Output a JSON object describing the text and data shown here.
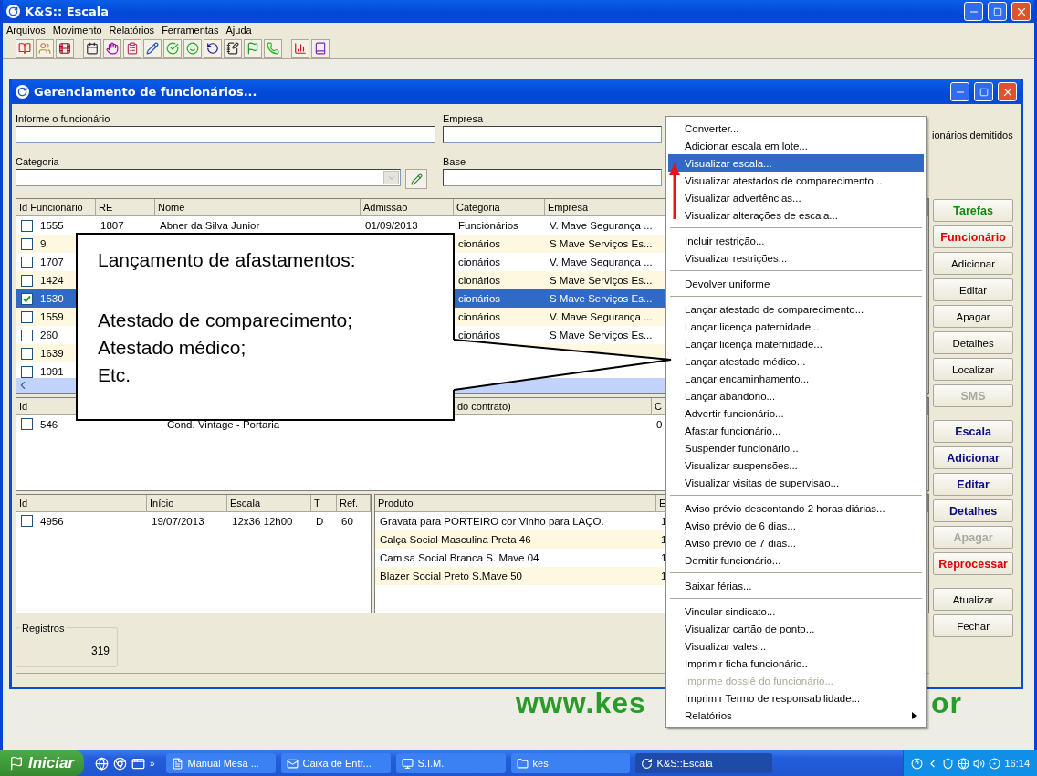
{
  "app": {
    "title": "K&S:: Escala",
    "menu": [
      "Arquivos",
      "Movimento",
      "Relatórios",
      "Ferramentas",
      "Ajuda"
    ]
  },
  "child": {
    "title": "Gerenciamento de funcionários...",
    "fields": [
      {
        "label": "Informe o funcionário",
        "kind": "text"
      },
      {
        "label": "Empresa",
        "kind": "text"
      },
      {
        "label": "Categoria",
        "kind": "combo"
      },
      {
        "label": "Base",
        "kind": "text"
      }
    ],
    "dismissed_option": "ionários demitidos",
    "employees": {
      "columns": [
        "Id Funcionário",
        "RE",
        "Nome",
        "Admissão",
        "Categoria",
        "Empresa"
      ],
      "rows": [
        {
          "checked": false,
          "selected": false,
          "cells": [
            "1555",
            "1807",
            "Abner da Silva Junior",
            "01/09/2013",
            "Funcionários",
            "V. Mave Segurança ..."
          ]
        },
        {
          "checked": false,
          "selected": false,
          "cells": [
            "9",
            null,
            null,
            null,
            "cionários",
            "S Mave Serviços Es..."
          ]
        },
        {
          "checked": false,
          "selected": false,
          "cells": [
            "1707",
            null,
            null,
            null,
            "cionários",
            "V. Mave Segurança ..."
          ]
        },
        {
          "checked": false,
          "selected": false,
          "cells": [
            "1424",
            null,
            null,
            null,
            "cionários",
            "S Mave Serviços Es..."
          ]
        },
        {
          "checked": true,
          "selected": true,
          "cells": [
            "1530",
            null,
            null,
            null,
            "cionários",
            "S Mave Serviços Es..."
          ]
        },
        {
          "checked": false,
          "selected": false,
          "cells": [
            "1559",
            null,
            null,
            null,
            "cionários",
            "V. Mave Segurança ..."
          ]
        },
        {
          "checked": false,
          "selected": false,
          "cells": [
            "260",
            null,
            null,
            null,
            "cionários",
            "S Mave Serviços Es..."
          ]
        },
        {
          "checked": false,
          "selected": false,
          "cells": [
            "1639",
            null,
            null,
            null,
            null,
            null
          ]
        },
        {
          "checked": false,
          "selected": false,
          "cells": [
            "1091",
            null,
            null,
            null,
            null,
            null
          ]
        }
      ]
    },
    "contracts": {
      "columns": [
        "Id",
        null,
        "do contrato)",
        "C"
      ],
      "rows": [
        {
          "checked": false,
          "cells": [
            "546",
            "Cond. Vintage - Portaria",
            null,
            "0"
          ]
        }
      ]
    },
    "schedules": {
      "columns": [
        "Id",
        "Início",
        "Escala",
        "T",
        "Ref."
      ],
      "rows": [
        {
          "checked": false,
          "cells": [
            "4956",
            "19/07/2013",
            "12x36 12h00",
            "D",
            "60"
          ]
        }
      ]
    },
    "products": {
      "columns": [
        "Produto",
        "E"
      ],
      "rows": [
        {
          "cells": [
            "Gravata para PORTEIRO cor Vinho para LAÇO.",
            "1"
          ]
        },
        {
          "cells": [
            "Calça Social Masculina Preta 46",
            "1"
          ]
        },
        {
          "cells": [
            "Camisa Social Branca  S. Mave 04",
            "1"
          ]
        },
        {
          "cells": [
            "Blazer Social Preto S.Mave 50",
            "1"
          ]
        }
      ]
    },
    "records": {
      "label": "Registros",
      "value": "319"
    },
    "button_groups": [
      [
        {
          "label": "Tarefas",
          "kind": "go",
          "disabled": false
        },
        {
          "label": "Funcionário",
          "kind": "alert",
          "disabled": false
        },
        {
          "label": "Adicionar",
          "kind": "plain",
          "disabled": false
        },
        {
          "label": "Editar",
          "kind": "plain",
          "disabled": false
        },
        {
          "label": "Apagar",
          "kind": "plain",
          "disabled": false
        },
        {
          "label": "Detalhes",
          "kind": "plain",
          "disabled": false
        },
        {
          "label": "Localizar",
          "kind": "plain",
          "disabled": false
        },
        {
          "label": "SMS",
          "kind": "strong",
          "disabled": true
        }
      ],
      [
        {
          "label": "Escala",
          "kind": "section",
          "disabled": false
        },
        {
          "label": "Adicionar",
          "kind": "section",
          "disabled": false
        },
        {
          "label": "Editar",
          "kind": "section",
          "disabled": false
        },
        {
          "label": "Detalhes",
          "kind": "section",
          "disabled": false
        },
        {
          "label": "Apagar",
          "kind": "section",
          "disabled": true
        },
        {
          "label": "Reprocessar",
          "kind": "alert",
          "disabled": false
        }
      ],
      [
        {
          "label": "Atualizar",
          "kind": "plain",
          "disabled": false
        },
        {
          "label": "Fechar",
          "kind": "plain",
          "disabled": false
        }
      ]
    ]
  },
  "context_menu": [
    [
      {
        "label": "Converter...",
        "selected": false,
        "disabled": false,
        "submenu": false
      },
      {
        "label": "Adicionar escala em lote...",
        "selected": false,
        "disabled": false,
        "submenu": false
      },
      {
        "label": "Visualizar escala...",
        "selected": true,
        "disabled": false,
        "submenu": false
      },
      {
        "label": "Visualizar atestados de comparecimento...",
        "selected": false,
        "disabled": false,
        "submenu": false
      },
      {
        "label": "Visualizar advertências...",
        "selected": false,
        "disabled": false,
        "submenu": false
      },
      {
        "label": "Visualizar alterações de escala...",
        "selected": false,
        "disabled": false,
        "submenu": false
      }
    ],
    [
      {
        "label": "Incluir restrição...",
        "selected": false,
        "disabled": false,
        "submenu": false
      },
      {
        "label": "Visualizar restrições...",
        "selected": false,
        "disabled": false,
        "submenu": false
      }
    ],
    [
      {
        "label": "Devolver uniforme",
        "selected": false,
        "disabled": false,
        "submenu": false
      }
    ],
    [
      {
        "label": "Lançar atestado de comparecimento...",
        "selected": false,
        "disabled": false,
        "submenu": false
      },
      {
        "label": "Lançar licença paternidade...",
        "selected": false,
        "disabled": false,
        "submenu": false
      },
      {
        "label": "Lançar licença maternidade...",
        "selected": false,
        "disabled": false,
        "submenu": false
      },
      {
        "label": "Lançar atestado médico...",
        "selected": false,
        "disabled": false,
        "submenu": false
      },
      {
        "label": "Lançar encaminhamento...",
        "selected": false,
        "disabled": false,
        "submenu": false
      },
      {
        "label": "Lançar abandono...",
        "selected": false,
        "disabled": false,
        "submenu": false
      },
      {
        "label": "Advertir funcionário...",
        "selected": false,
        "disabled": false,
        "submenu": false
      },
      {
        "label": "Afastar funcionário...",
        "selected": false,
        "disabled": false,
        "submenu": false
      },
      {
        "label": "Suspender funcionário...",
        "selected": false,
        "disabled": false,
        "submenu": false
      },
      {
        "label": "Visualizar suspensões...",
        "selected": false,
        "disabled": false,
        "submenu": false
      },
      {
        "label": "Visualizar visitas de supervisao...",
        "selected": false,
        "disabled": false,
        "submenu": false
      }
    ],
    [
      {
        "label": "Aviso prévio descontando 2 horas diárias...",
        "selected": false,
        "disabled": false,
        "submenu": false
      },
      {
        "label": "Aviso prévio de 6 dias...",
        "selected": false,
        "disabled": false,
        "submenu": false
      },
      {
        "label": "Aviso prévio de 7 dias...",
        "selected": false,
        "disabled": false,
        "submenu": false
      },
      {
        "label": "Demitir funcionário...",
        "selected": false,
        "disabled": false,
        "submenu": false
      }
    ],
    [
      {
        "label": "Baixar férias...",
        "selected": false,
        "disabled": false,
        "submenu": false
      }
    ],
    [
      {
        "label": "Vincular sindicato...",
        "selected": false,
        "disabled": false,
        "submenu": false
      },
      {
        "label": "Visualizar cartão de ponto...",
        "selected": false,
        "disabled": false,
        "submenu": false
      },
      {
        "label": "Visualizar vales...",
        "selected": false,
        "disabled": false,
        "submenu": false
      },
      {
        "label": "Imprimir ficha funcionário..",
        "selected": false,
        "disabled": false,
        "submenu": false
      },
      {
        "label": "Imprime dossiê do funcionário...",
        "selected": false,
        "disabled": true,
        "submenu": false
      },
      {
        "label": "Imprimir Termo de responsabilidade...",
        "selected": false,
        "disabled": false,
        "submenu": false
      },
      {
        "label": "Relatórios",
        "selected": false,
        "disabled": false,
        "submenu": true
      }
    ]
  ],
  "callout": {
    "title": "Lançamento de afastamentos:",
    "lines": [
      "Atestado de comparecimento;",
      "Atestado médico;",
      "Etc."
    ]
  },
  "background_text": [
    "www.kes",
    "or"
  ],
  "taskbar": {
    "start": "Iniciar",
    "more": "»",
    "tasks": [
      {
        "label": "Manual Mesa ...",
        "selected": false
      },
      {
        "label": "Caixa de Entr...",
        "selected": false
      },
      {
        "label": "S.I.M.",
        "selected": false
      },
      {
        "label": "kes",
        "selected": false
      },
      {
        "label": "K&S::Escala",
        "selected": true
      }
    ],
    "clock": "16:14"
  }
}
